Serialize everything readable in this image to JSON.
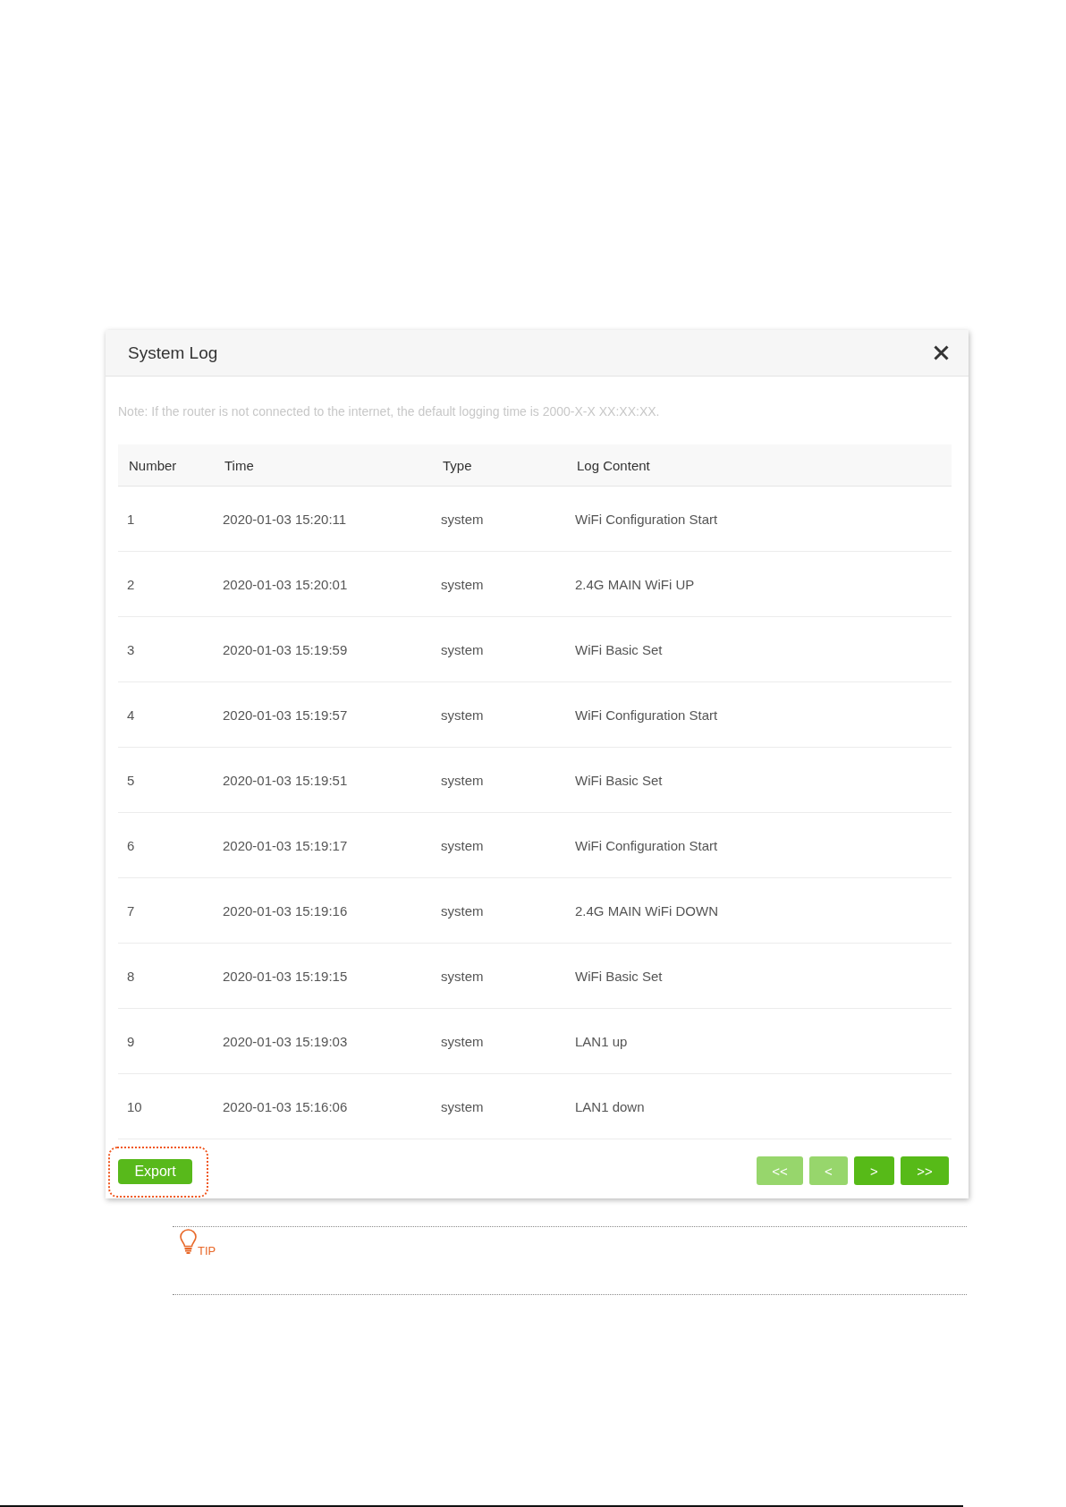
{
  "dialog": {
    "title": "System Log",
    "note": "Note: If the router is not connected to the internet, the default logging time is 2000-X-X XX:XX:XX.",
    "table": {
      "columns": [
        "Number",
        "Time",
        "Type",
        "Log Content"
      ],
      "rows": [
        {
          "number": "1",
          "time": "2020-01-03 15:20:11",
          "type": "system",
          "log_content": "WiFi Configuration Start"
        },
        {
          "number": "2",
          "time": "2020-01-03 15:20:01",
          "type": "system",
          "log_content": "2.4G MAIN WiFi UP"
        },
        {
          "number": "3",
          "time": "2020-01-03 15:19:59",
          "type": "system",
          "log_content": "WiFi Basic Set"
        },
        {
          "number": "4",
          "time": "2020-01-03 15:19:57",
          "type": "system",
          "log_content": "WiFi Configuration Start"
        },
        {
          "number": "5",
          "time": "2020-01-03 15:19:51",
          "type": "system",
          "log_content": "WiFi Basic Set"
        },
        {
          "number": "6",
          "time": "2020-01-03 15:19:17",
          "type": "system",
          "log_content": "WiFi Configuration Start"
        },
        {
          "number": "7",
          "time": "2020-01-03 15:19:16",
          "type": "system",
          "log_content": "2.4G MAIN WiFi DOWN"
        },
        {
          "number": "8",
          "time": "2020-01-03 15:19:15",
          "type": "system",
          "log_content": "WiFi Basic Set"
        },
        {
          "number": "9",
          "time": "2020-01-03 15:19:03",
          "type": "system",
          "log_content": "LAN1 up"
        },
        {
          "number": "10",
          "time": "2020-01-03 15:16:06",
          "type": "system",
          "log_content": "LAN1 down"
        }
      ]
    },
    "export_button": {
      "label": "Export",
      "highlighted": true
    },
    "pagination": [
      {
        "label": "<<",
        "disabled": true
      },
      {
        "label": "<",
        "disabled": true
      },
      {
        "label": ">",
        "disabled": false
      },
      {
        "label": ">>",
        "disabled": false
      }
    ]
  },
  "tip": {
    "label": "TIP"
  }
}
